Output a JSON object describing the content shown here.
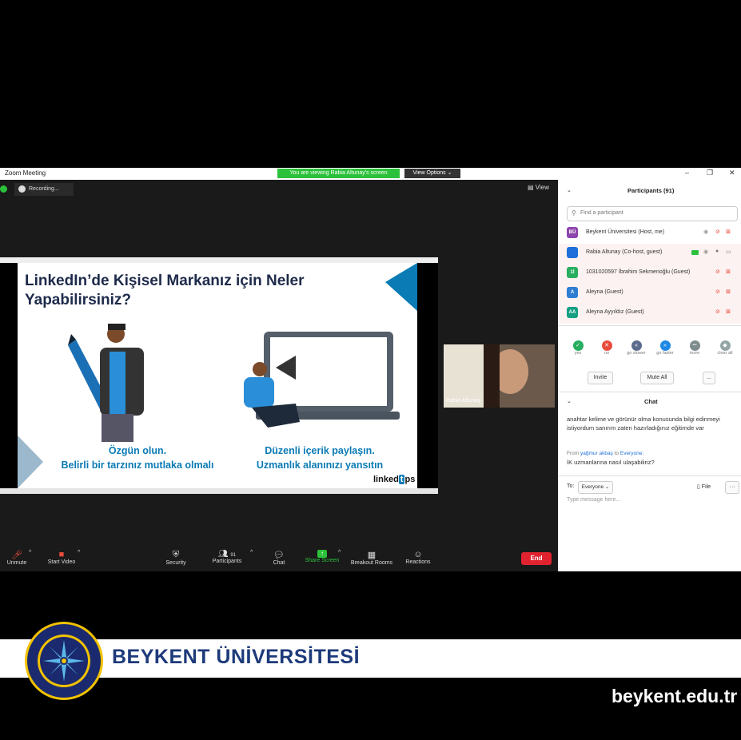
{
  "window": {
    "title": "Zoom Meeting",
    "viewing_banner": "You are viewing Rabia Altunay's screen",
    "view_options": "View Options",
    "controls": [
      "–",
      "❐",
      "✕"
    ]
  },
  "recording": {
    "label": "Recording..."
  },
  "view_button": "View",
  "slide": {
    "title": "LinkedIn’de Kişisel Markanız için Neler Yapabilirsiniz?",
    "left_caption_1": "Özgün olun.",
    "left_caption_2": "Belirli bir tarzınız mutlaka olmalı",
    "right_caption_1": "Düzenli içerik paylaşın.",
    "right_caption_2": "Uzmanlık alanınızı yansıtın",
    "brand": "linked",
    "brand_tail": "ps"
  },
  "video": {
    "name": "Rabia Altunay"
  },
  "toolbar": {
    "unmute": "Unmute",
    "start_video": "Start Video",
    "security": "Security",
    "participants": "Participants",
    "participants_count": "91",
    "chat": "Chat",
    "share_screen": "Share Screen",
    "breakout_rooms": "Breakout Rooms",
    "reactions": "Reactions",
    "end": "End"
  },
  "participants_panel": {
    "title": "Participants (91)",
    "search_placeholder": "Find a participant",
    "list": [
      {
        "initials": "BÜ",
        "name": "Beykent Üniversitesi (Host, me)",
        "color": "#8e44ad"
      },
      {
        "initials": "",
        "name": "Rabia Altunay (Co-host, guest)",
        "color": "#1e6fd9"
      },
      {
        "initials": "1İ",
        "name": "1031020597 İbrahim Sekmenoğlu (Guest)",
        "color": "#27ae60"
      },
      {
        "initials": "A",
        "name": "Aleyna (Guest)",
        "color": "#2d7dd2"
      },
      {
        "initials": "AA",
        "name": "Aleyna Ayyıldız (Guest)",
        "color": "#16a085"
      }
    ],
    "reactions": [
      {
        "label": "yes",
        "color": "#27ae60",
        "glyph": "✓"
      },
      {
        "label": "no",
        "color": "#e74c3c",
        "glyph": "✕"
      },
      {
        "label": "go slower",
        "color": "#5b6b8c",
        "glyph": "«"
      },
      {
        "label": "go faster",
        "color": "#1e88e5",
        "glyph": "»"
      },
      {
        "label": "more",
        "color": "#7f8c8d",
        "glyph": "•••"
      },
      {
        "label": "clear all",
        "color": "#95a5a6",
        "glyph": "◆"
      }
    ],
    "invite": "Invite",
    "mute_all": "Mute All",
    "more": "..."
  },
  "chat_panel": {
    "title": "Chat",
    "message_1": "anahtar kelime ve görünür olma konusunda bilgi edinmeyi istiyordum sanırım zaten hazırladığınız eğitimde var",
    "from_label": "From",
    "from_name": "yağmur akbaş",
    "to_label": "to",
    "to_name": "Everyone:",
    "message_2": "İK uzmanlarına nasıl ulaşabiliriz?",
    "to_prefix": "To:",
    "recipient": "Everyone",
    "file": "File",
    "dots": "···",
    "input_placeholder": "Type message here..."
  },
  "branding": {
    "name": "BEYKENT ÜNİVERSİTESİ",
    "url": "beykent.edu.tr",
    "seal_text": "BEYKENT ÜNİVERSİTESİ · İSTANBUL · 1997"
  }
}
